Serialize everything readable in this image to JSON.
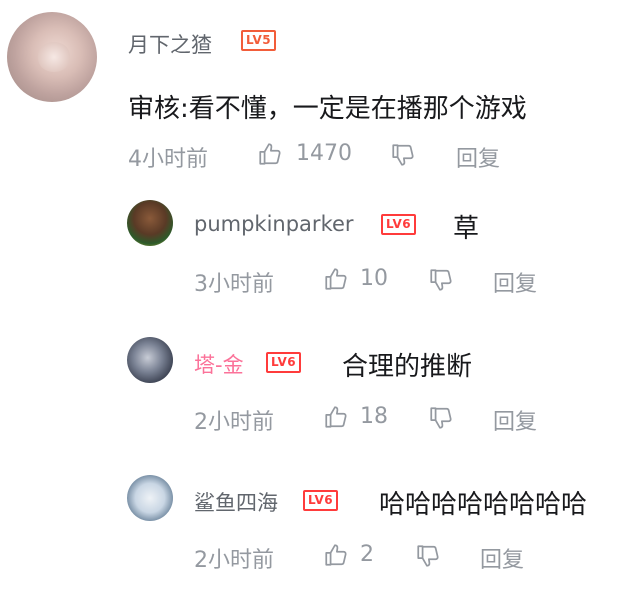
{
  "main_comment": {
    "username": "月下之猹",
    "level": "LV5",
    "content": "审核:看不懂，一定是在播那个游戏",
    "time": "4小时前",
    "likes": "1470",
    "reply_label": "回复"
  },
  "replies": [
    {
      "username": "pumpkinparker",
      "level": "LV6",
      "content": "草",
      "time": "3小时前",
      "likes": "10",
      "reply_label": "回复"
    },
    {
      "username": "塔-金",
      "level": "LV6",
      "content": "合理的推断",
      "time": "2小时前",
      "likes": "18",
      "reply_label": "回复"
    },
    {
      "username": "鲨鱼四海",
      "level": "LV6",
      "content": "哈哈哈哈哈哈哈哈",
      "time": "2小时前",
      "likes": "2",
      "reply_label": "回复"
    }
  ],
  "colors": {
    "username_gray": "#61666d",
    "username_pink": "#fb7299",
    "level_orange": "#f25d3a",
    "level_red": "#ff3b3b",
    "text": "#18191c",
    "meta": "#9499a0"
  },
  "icons": [
    "thumbs-up-icon",
    "thumbs-down-icon"
  ]
}
